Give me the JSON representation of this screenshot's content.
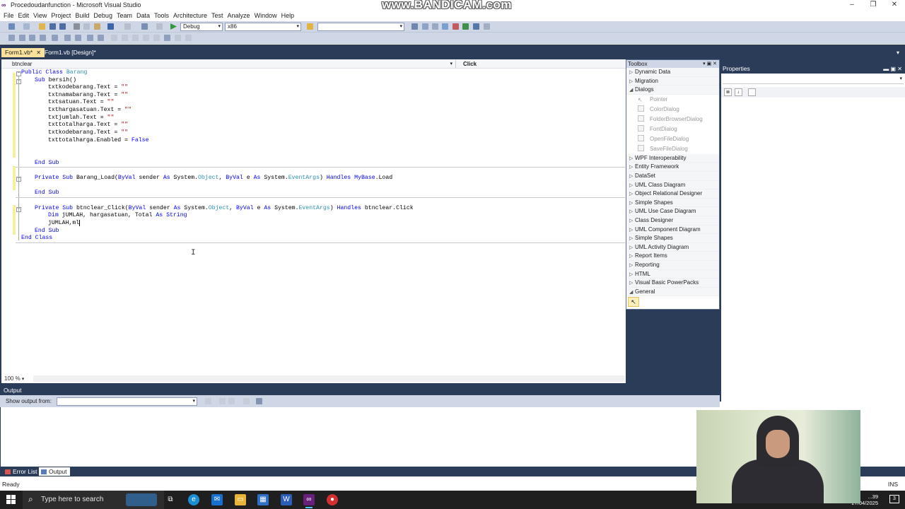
{
  "window": {
    "title": "Procedoudanfunction - Microsoft Visual Studio",
    "watermark": "www.BANDICAM.com",
    "controls": [
      "–",
      "❐",
      "✕"
    ]
  },
  "menu": [
    "File",
    "Edit",
    "View",
    "Project",
    "Build",
    "Debug",
    "Team",
    "Data",
    "Tools",
    "Architecture",
    "Test",
    "Analyze",
    "Window",
    "Help"
  ],
  "toolbar": {
    "config": "Debug",
    "platform": "x86",
    "find": ""
  },
  "tabs": [
    {
      "label": "Form1.vb*",
      "active": true,
      "close": "✕"
    },
    {
      "label": "Form1.vb [Design]*",
      "active": false
    }
  ],
  "navbar": {
    "object": "btnclear",
    "member": "Click"
  },
  "code": {
    "l1": {
      "kw": "Public Class",
      "name": "Barang"
    },
    "l2": {
      "kw": "Sub",
      "name": "bersih()"
    },
    "assign": [
      {
        "lhs": "txtkodebarang.Text = ",
        "rhs": "\"\""
      },
      {
        "lhs": "txtnamabarang.Text = ",
        "rhs": "\"\""
      },
      {
        "lhs": "txtsatuan.Text = ",
        "rhs": "\"\""
      },
      {
        "lhs": "txthargasatuan.Text = ",
        "rhs": "\"\""
      },
      {
        "lhs": "txtjumlah.Text = ",
        "rhs": "\"\""
      },
      {
        "lhs": "txttotalharga.Text = ",
        "rhs": "\"\""
      },
      {
        "lhs": "txtkodebarang.Text = ",
        "rhs": "\"\""
      }
    ],
    "enabled": {
      "lhs": "txttotalharga.Enabled = ",
      "val": "False"
    },
    "endsub": "End Sub",
    "load": {
      "a": "Private Sub",
      "b": " Barang_Load(",
      "c": "ByVal",
      "d": " sender ",
      "e": "As",
      "f": " System.",
      "g": "Object",
      "h": ", ",
      "i": "ByVal",
      "j": " e ",
      "k": "As",
      "l": " System.",
      "m": "EventArgs",
      "n": ") ",
      "o": "Handles",
      "p": " ",
      "q": "MyBase",
      "r": ".Load"
    },
    "click": {
      "a": "Private Sub",
      "b": " btnclear_Click(",
      "c": "ByVal",
      "d": " sender ",
      "e": "As",
      "f": " System.",
      "g": "Object",
      "h": ", ",
      "i": "ByVal",
      "j": " e ",
      "k": "As",
      "l": " System.",
      "m": "EventArgs",
      "n": ") ",
      "o": "Handles",
      "p": " btnclear.Click"
    },
    "dim": {
      "a": "Dim",
      "b": " jUMLAH, hargasatuan, Total ",
      "c": "As String"
    },
    "typing": "jUMLAH,ml",
    "endclass": "End Class"
  },
  "zoom": "100 %",
  "toolbox": {
    "title": "Toolbox",
    "groups_top": [
      "Dynamic Data",
      "Migration"
    ],
    "open_group": "Dialogs",
    "tools": [
      "Pointer",
      "ColorDialog",
      "FolderBrowserDialog",
      "FontDialog",
      "OpenFileDialog",
      "SaveFileDialog"
    ],
    "groups_bottom": [
      "WPF Interoperability",
      "Entity Framework",
      "DataSet",
      "UML Class Diagram",
      "Object Relational Designer",
      "Simple Shapes",
      "UML Use Case Diagram",
      "Class Designer",
      "UML Component Diagram",
      "Simple Shapes",
      "UML Activity Diagram",
      "Report Items",
      "Reporting",
      "HTML",
      "Visual Basic PowerPacks"
    ],
    "general": "General"
  },
  "properties": {
    "title": "Properties"
  },
  "output": {
    "title": "Output",
    "show_from": "Show output from:"
  },
  "bottom_tabs": [
    "Error List",
    "Output"
  ],
  "status": {
    "ready": "Ready",
    "ins": "INS"
  },
  "taskbar": {
    "search": "Type here to search",
    "time": "...39",
    "date": "27/04/2025",
    "notif": "3"
  }
}
